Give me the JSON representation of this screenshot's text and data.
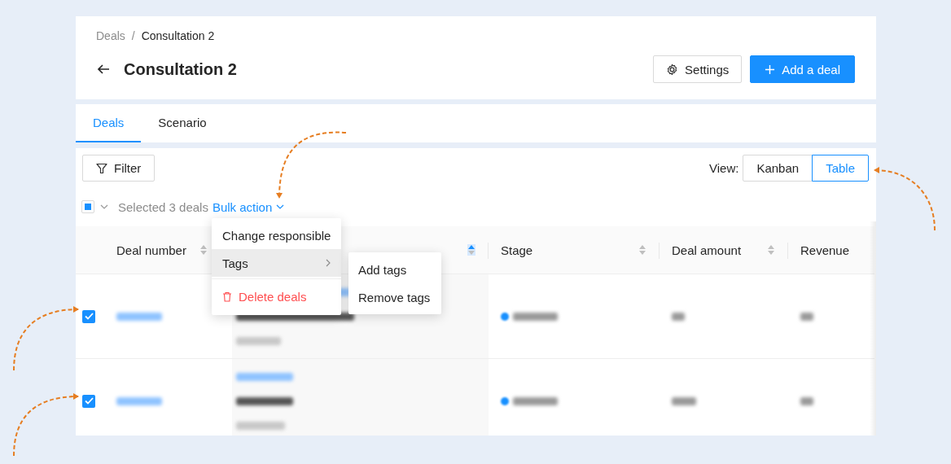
{
  "breadcrumbs": [
    "Deals",
    "Consultation 2"
  ],
  "breadcrumb_separator": "/",
  "title": "Consultation 2",
  "header_buttons": [
    {
      "kind": "settings",
      "label": "Settings"
    },
    {
      "kind": "add",
      "label": "Add a deal"
    }
  ],
  "tabs": [
    {
      "label": "Deals",
      "selected": true
    },
    {
      "label": "Scenario",
      "selected": false
    }
  ],
  "filter_button": "Filter",
  "view": {
    "label": "View:",
    "options": [
      {
        "label": "Kanban",
        "selected": false
      },
      {
        "label": "Table",
        "selected": true
      }
    ]
  },
  "selection": {
    "indeterminate": true,
    "text": "Selected 3 deals",
    "bulk_action": "Bulk action"
  },
  "columns": [
    {
      "label": "Deal number",
      "sorted_ascending": false
    },
    {
      "sorted_ascending": true
    },
    {
      "label": "Stage",
      "sorted_ascending": false
    },
    {
      "label": "Deal amount",
      "sorted_ascending": false
    },
    {
      "label": "Revenue"
    }
  ],
  "rows": [
    {
      "checked": true
    },
    {
      "checked": true
    }
  ],
  "bulk_menu": [
    {
      "kind": "item",
      "label": "Change responsible",
      "selected": false
    },
    {
      "kind": "submenu",
      "label": "Tags",
      "selected": true
    },
    {
      "kind": "divider"
    },
    {
      "kind": "danger",
      "label": "Delete deals",
      "selected": false
    }
  ],
  "tags_submenu": [
    "Add tags",
    "Remove tags"
  ]
}
